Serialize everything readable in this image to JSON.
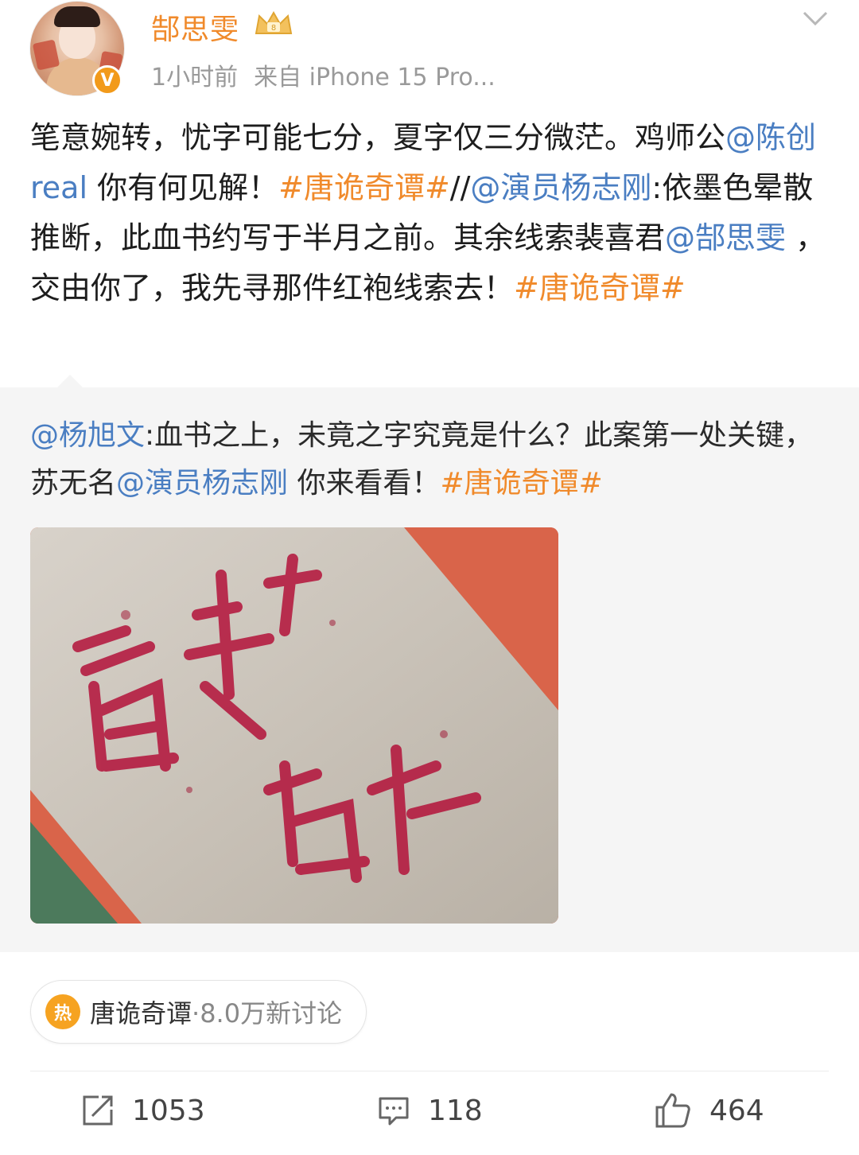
{
  "post": {
    "username": "郜思雯",
    "time": "1小时前",
    "source": "来自 iPhone 15 Pro...",
    "text": {
      "p1": "笔意婉转，忧字可能七分，夏字仅三分微茫。鸡师公",
      "m1": "@陈创 real",
      "p2": " 你有何见解！",
      "t1": "#唐诡奇谭#",
      "p3": "//",
      "m2": "@演员杨志刚",
      "p4": ":依墨色晕散推断，此血书约写于半月之前。其余线索裴喜君",
      "m3": "@郜思雯",
      "p5": " ，交由你了，我先寻那件红袍线索去！",
      "t2": "#唐诡奇谭#"
    }
  },
  "quote": {
    "m1": "@杨旭文",
    "p1": ":血书之上，未竟之字究竟是什么？此案第一处关键，苏无名",
    "m2": "@演员杨志刚",
    "p2": " 你来看看！",
    "t1": "#唐诡奇谭#"
  },
  "topic_pill": {
    "icon_text": "热",
    "name": "唐诡奇谭",
    "count": "·8.0万新讨论"
  },
  "actions": {
    "repost": "1053",
    "comment": "118",
    "like": "464"
  },
  "colors": {
    "mention": "#4a7ec2",
    "topic": "#f08a2b",
    "username": "#f08a2b"
  }
}
